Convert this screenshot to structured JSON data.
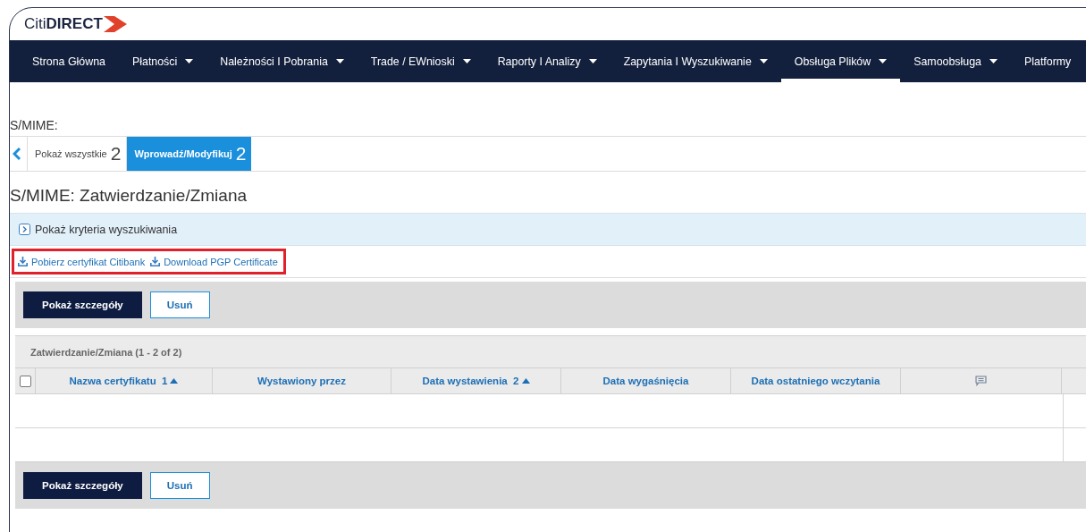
{
  "logo": {
    "light": "Citi",
    "bold": "DIRECT"
  },
  "nav": [
    {
      "label": "Strona Główna",
      "dropdown": false,
      "selected": false
    },
    {
      "label": "Płatności",
      "dropdown": true,
      "selected": false
    },
    {
      "label": "Należności I Pobrania",
      "dropdown": true,
      "selected": false
    },
    {
      "label": "Trade / EWnioski",
      "dropdown": true,
      "selected": false
    },
    {
      "label": "Raporty I Analizy",
      "dropdown": true,
      "selected": false
    },
    {
      "label": "Zapytania I Wyszukiwanie",
      "dropdown": true,
      "selected": false
    },
    {
      "label": "Obsługa Plików",
      "dropdown": true,
      "selected": true
    },
    {
      "label": "Samoobsługa",
      "dropdown": true,
      "selected": false
    },
    {
      "label": "Platformy",
      "dropdown": false,
      "selected": false
    }
  ],
  "section_label": "S/MIME:",
  "tabs": [
    {
      "label": "Pokaż wszystkie",
      "count": "2",
      "selected": false
    },
    {
      "label": "Wprowadź/Modyfikuj",
      "count": "2",
      "selected": true
    }
  ],
  "page_title": "S/MIME: Zatwierdzanie/Zmiana",
  "search_toggle": {
    "label": "Pokaż kryteria wyszukiwania",
    "expanded": false
  },
  "download_links": [
    "Pobierz certyfikat Citibank",
    "Download PGP Certificate"
  ],
  "toolbar_top": [
    {
      "label": "Pokaż szczegóły",
      "kind": "primary"
    },
    {
      "label": "Usuń",
      "kind": "secondary"
    }
  ],
  "table": {
    "caption": "Zatwierdzanie/Zmiana (1 - 2 of 2)",
    "select_all_checked": false,
    "columns": [
      {
        "kind": "text",
        "label": "Nazwa certyfikatu",
        "sort_order": "1"
      },
      {
        "kind": "text",
        "label": "Wystawiony przez"
      },
      {
        "kind": "text",
        "label": "Data wystawienia",
        "sort_order": "2"
      },
      {
        "kind": "text",
        "label": "Data wygaśnięcia"
      },
      {
        "kind": "text",
        "label": "Data ostatniego wczytania"
      },
      {
        "kind": "comment"
      }
    ]
  },
  "toolbar_bottom": [
    {
      "label": "Pokaż szczegóły",
      "kind": "primary"
    },
    {
      "label": "Usuń",
      "kind": "secondary"
    }
  ]
}
